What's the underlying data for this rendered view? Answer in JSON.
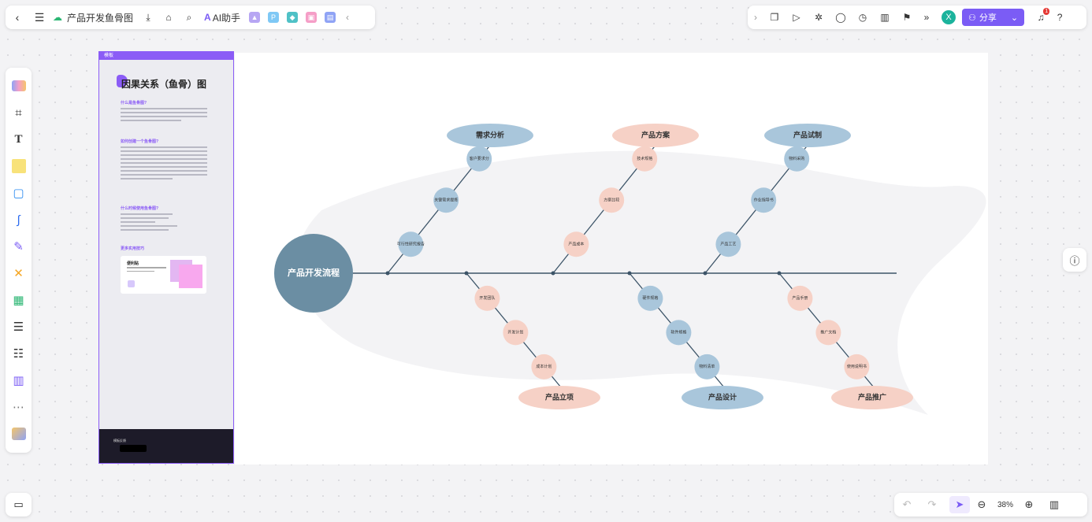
{
  "header": {
    "doc_title": "产品开发鱼骨图",
    "ai_label": "AI助手",
    "share_label": "分享",
    "avatar_letter": "X",
    "notification_count": "1"
  },
  "template": {
    "tag": "模板",
    "title": "因果关系（鱼骨）图",
    "section1": "什么是鱼骨图?",
    "section2": "如何创建一个鱼骨图?",
    "section3": "什么时候使用鱼骨图?",
    "section4": "更多实用技巧",
    "card_title": "便利贴",
    "bottom_label": "模板反馈"
  },
  "diagram": {
    "head": "产品开发流程",
    "top_categories": [
      "需求分析",
      "产品方案",
      "产品试制"
    ],
    "bottom_categories": [
      "产品立项",
      "产品设计",
      "产品推广"
    ],
    "top_nodes": [
      [
        "客户要求分",
        "关键需求提炼",
        "可行性研究报告"
      ],
      [
        "技术规格",
        "方案比较",
        "产品成本"
      ],
      [
        "物料采购",
        "作业指导书",
        "产品工艺"
      ]
    ],
    "bottom_nodes": [
      [
        "开发团队",
        "开发计划",
        "成本计划"
      ],
      [
        "硬件规格",
        "软件规格",
        "物料清单"
      ],
      [
        "产品手册",
        "推广文档",
        "使用说明书"
      ]
    ]
  },
  "zoom": {
    "level": "38%"
  },
  "colors": {
    "accent": "#7b5cf5",
    "head": "#6b8ea3",
    "blue_node": "#a9c6db",
    "pink_node": "#f6d1c6",
    "spine": "#3c5468"
  }
}
